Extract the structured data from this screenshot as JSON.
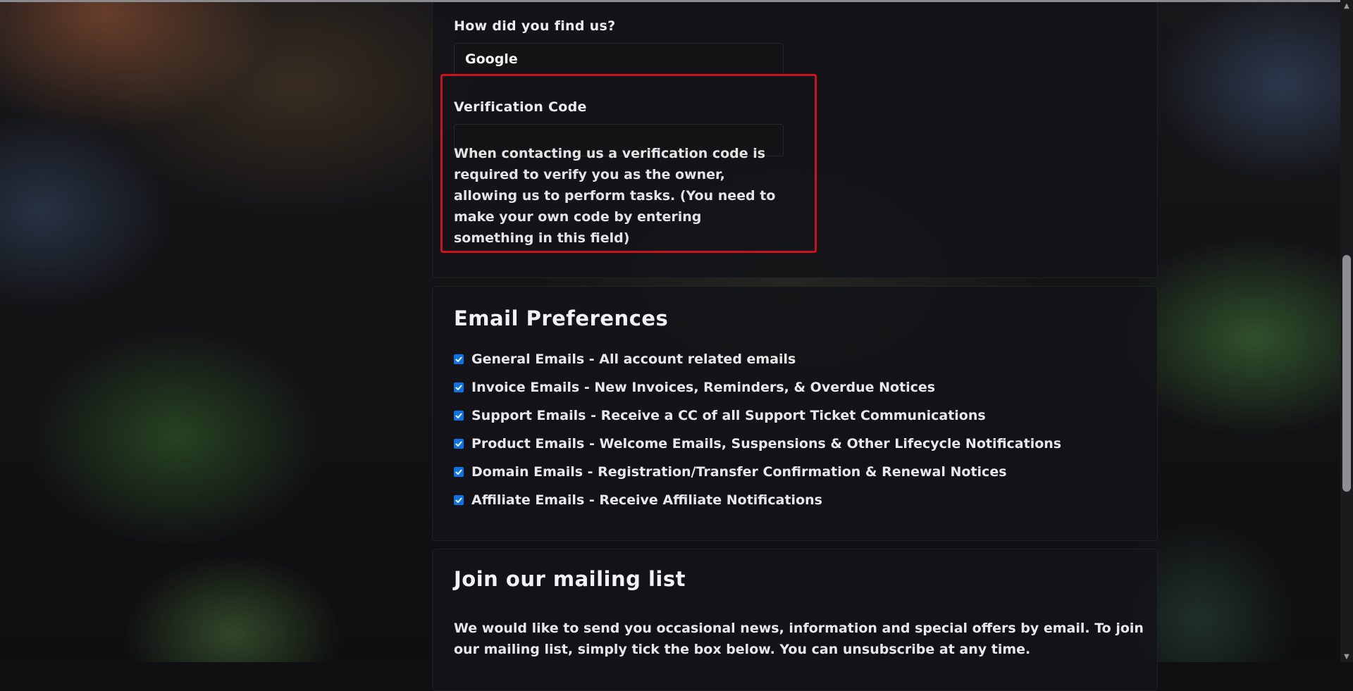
{
  "contact": {
    "find_us_label": "How did you find us?",
    "find_us_value": "Google",
    "verification_label": "Verification Code",
    "verification_value": "",
    "verification_help": "When contacting us a verification code is required to verify you as the owner, allowing us to perform tasks. (You need to make your own code by entering something in this field)"
  },
  "email_preferences": {
    "title": "Email Preferences",
    "items": [
      {
        "label": "General Emails - All account related emails",
        "checked": true
      },
      {
        "label": "Invoice Emails - New Invoices, Reminders, & Overdue Notices",
        "checked": true
      },
      {
        "label": "Support Emails - Receive a CC of all Support Ticket Communications",
        "checked": true
      },
      {
        "label": "Product Emails - Welcome Emails, Suspensions & Other Lifecycle Notifications",
        "checked": true
      },
      {
        "label": "Domain Emails - Registration/Transfer Confirmation & Renewal Notices",
        "checked": true
      },
      {
        "label": "Affiliate Emails - Receive Affiliate Notifications",
        "checked": true
      }
    ]
  },
  "mailing_list": {
    "title": "Join our mailing list",
    "description": "We would like to send you occasional news, information and special offers by email. To join our mailing list, simply tick the box below. You can unsubscribe at any time."
  },
  "scrollbar": {
    "up_icon": "▲",
    "down_icon": "▼"
  },
  "colors": {
    "highlight_border": "#c8141a",
    "checkbox_accent": "#0a74e6"
  }
}
